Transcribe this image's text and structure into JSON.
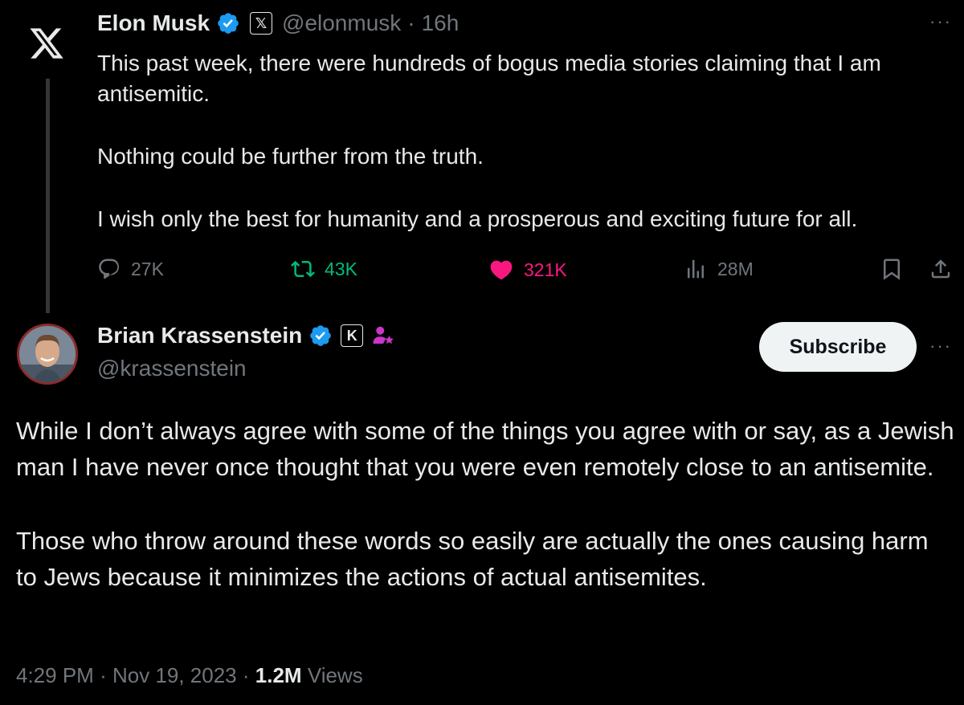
{
  "original_tweet": {
    "author_name": "Elon Musk",
    "handle": "@elonmusk",
    "separator": "·",
    "time_ago": "16h",
    "affiliate_badge": "𝕏",
    "paragraphs": [
      "This past week, there were hundreds of bogus media stories claiming that I am antisemitic.",
      "Nothing could be further from the truth.",
      "I wish only the best for humanity and a prosperous and exciting future for all."
    ],
    "replies": "27K",
    "reposts": "43K",
    "likes": "321K",
    "views": "28M",
    "more": "···"
  },
  "reply_tweet": {
    "author_name": "Brian Krassenstein",
    "handle": "@krassenstein",
    "badge_letter": "K",
    "subscribe_label": "Subscribe",
    "more": "···",
    "paragraphs": [
      "While I don’t always agree with some of the things you agree with or say, as a Jewish man I have never once thought that you were even remotely close to an antisemite.",
      "Those who throw around these words so easily are actually the ones causing harm to Jews because it minimizes the actions of actual antisemites."
    ],
    "time": "4:29 PM",
    "separator1": "·",
    "date": "Nov 19, 2023",
    "separator2": "·",
    "view_count": "1.2M",
    "views_label": "Views"
  },
  "colors": {
    "verified": "#1d9bf0",
    "like": "#f91880",
    "repost": "#00ba7c",
    "muted": "#71767b",
    "text": "#e7e9ea",
    "background": "#000000"
  },
  "icons": [
    "x-logo-icon",
    "verified-icon",
    "reply-icon",
    "repost-icon",
    "like-icon",
    "views-icon",
    "bookmark-icon",
    "share-icon",
    "more-icon",
    "subscriber-star-icon"
  ]
}
